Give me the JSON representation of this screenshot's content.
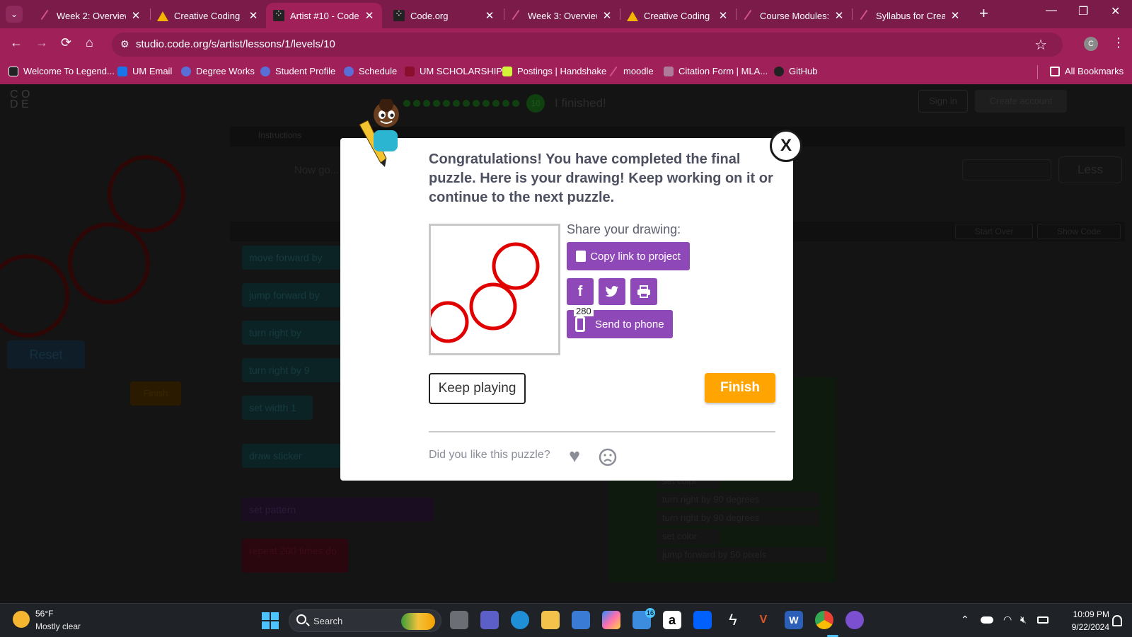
{
  "browser": {
    "tabs": [
      {
        "label": "Week 2: Overview",
        "icon": "canvas-icon"
      },
      {
        "label": "Creative Coding 1",
        "icon": "drive-icon"
      },
      {
        "label": "Artist #10 - Code.o",
        "icon": "codeorg-icon",
        "active": true
      },
      {
        "label": "Code.org",
        "icon": "codeorg-icon"
      },
      {
        "label": "Week 3: Overview",
        "icon": "canvas-icon"
      },
      {
        "label": "Creative Coding 1",
        "icon": "drive-icon"
      },
      {
        "label": "Course Modules: C",
        "icon": "canvas-icon"
      },
      {
        "label": "Syllabus for Creati",
        "icon": "canvas-icon"
      }
    ],
    "url": "studio.code.org/s/artist/lessons/1/levels/10",
    "profile_initial": "C",
    "bookmarks": [
      {
        "label": "Welcome To Legend...",
        "color": "#222222"
      },
      {
        "label": "UM Email",
        "color": "#1a73e8"
      },
      {
        "label": "Degree Works",
        "color": "#5a6fd6"
      },
      {
        "label": "Student Profile",
        "color": "#5a6fd6"
      },
      {
        "label": "Schedule",
        "color": "#5a6fd6"
      },
      {
        "label": "UM SCHOLARSHIP",
        "color": "#8a0f2e"
      },
      {
        "label": "Postings | Handshake",
        "color": "#d4f238"
      },
      {
        "label": "moodle",
        "color": "#c45588"
      },
      {
        "label": "Citation Form | MLA...",
        "color": "#b07a9a"
      },
      {
        "label": "GitHub",
        "color": "#222222"
      }
    ],
    "all_bookmarks": "All Bookmarks"
  },
  "page": {
    "progress_level": "10",
    "finished": "I finished!",
    "sign_in": "Sign in",
    "create_account": "Create account",
    "instructions_tab": "Instructions",
    "instructions_text": "Now go... an empty function that you can ma...",
    "less": "Less",
    "start_over": "Start Over",
    "show_code": "Show Code",
    "reset": "Reset",
    "finish_small": "Finish",
    "toolbox_blocks": [
      "move forward by",
      "jump forward by",
      "turn right by",
      "turn right by 9",
      "set width 1",
      "draw sticker",
      "set pattern",
      "repeat 200 times do"
    ],
    "workspace_blocks": [
      "set color",
      "turn right by 90 degrees",
      "turn right by 90 degrees",
      "set color",
      "jump forward by 50 pixels"
    ]
  },
  "modal": {
    "message": "Congratulations! You have completed the final puzzle. Here is your drawing! Keep working on it or continue to the next puzzle.",
    "share_label": "Share your drawing:",
    "copy_link": "Copy link to project",
    "char_count": "280",
    "send_to_phone": "Send to phone",
    "keep_playing": "Keep playing",
    "finish": "Finish",
    "feedback_prompt": "Did you like this puzzle?",
    "close": "X",
    "colors": {
      "primary": "#8e48b8",
      "finish": "#ffa400",
      "drawing": "#e00000"
    }
  },
  "taskbar": {
    "temperature": "56°F",
    "weather": "Mostly clear",
    "search_placeholder": "Search",
    "mail_badge": "16",
    "time": "10:09 PM",
    "date": "9/22/2024"
  }
}
